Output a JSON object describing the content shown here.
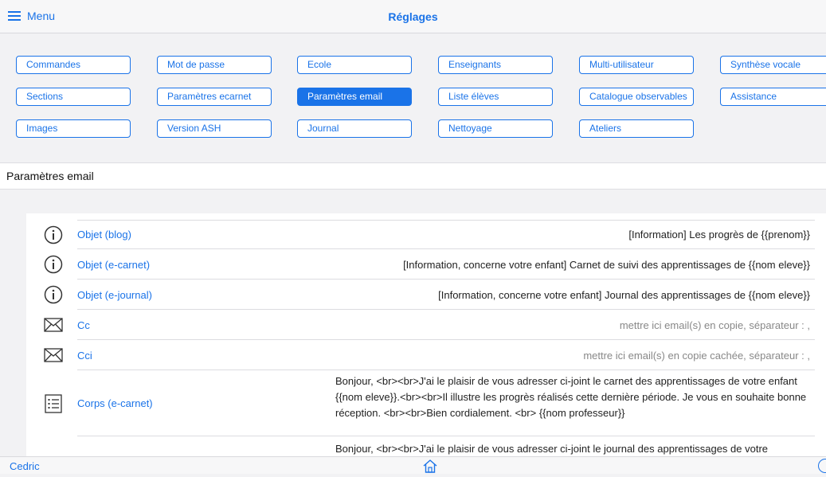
{
  "header": {
    "menu_label": "Menu",
    "title": "Réglages"
  },
  "buttons": [
    {
      "label": "Commandes",
      "active": false
    },
    {
      "label": "Mot de passe",
      "active": false
    },
    {
      "label": "Ecole",
      "active": false
    },
    {
      "label": "Enseignants",
      "active": false
    },
    {
      "label": "Multi-utilisateur",
      "active": false
    },
    {
      "label": "Synthèse vocale",
      "active": false
    },
    {
      "label": "Sections",
      "active": false
    },
    {
      "label": "Paramètres ecarnet",
      "active": false
    },
    {
      "label": "Paramètres email",
      "active": true
    },
    {
      "label": "Liste élèves",
      "active": false
    },
    {
      "label": "Catalogue observables",
      "active": false
    },
    {
      "label": "Assistance",
      "active": false
    },
    {
      "label": "Images",
      "active": false
    },
    {
      "label": "Version ASH",
      "active": false
    },
    {
      "label": "Journal",
      "active": false
    },
    {
      "label": "Nettoyage",
      "active": false
    },
    {
      "label": "Ateliers",
      "active": false
    }
  ],
  "section": {
    "title": "Paramètres email"
  },
  "rows": [
    {
      "icon": "info-icon",
      "label": "Objet (blog)",
      "value": "[Information] Les progrès de {{prenom}}",
      "placeholder": false
    },
    {
      "icon": "info-icon",
      "label": "Objet (e-carnet)",
      "value": "[Information, concerne votre enfant] Carnet de suivi des apprentissages de {{nom eleve}}",
      "placeholder": false
    },
    {
      "icon": "info-icon",
      "label": "Objet (e-journal)",
      "value": "[Information, concerne votre enfant] Journal des apprentissages de {{nom eleve}}",
      "placeholder": false
    },
    {
      "icon": "envelope-icon",
      "label": "Cc",
      "value": "mettre ici email(s) en copie, séparateur : ,",
      "placeholder": true
    },
    {
      "icon": "envelope-icon",
      "label": "Cci",
      "value": "mettre ici email(s) en copie cachée, séparateur : ,",
      "placeholder": true
    }
  ],
  "body_rows": [
    {
      "icon": "list-icon",
      "label": "Corps (e-carnet)",
      "value": "Bonjour, <br><br>J'ai le plaisir de vous adresser ci-joint le carnet des apprentissages de votre enfant {{nom eleve}}.<br><br>Il illustre les progrès réalisés cette dernière période. Je vous en souhaite bonne réception. <br><br>Bien cordialement. <br> {{nom professeur}}"
    },
    {
      "icon": "list-icon",
      "label": "",
      "value": "Bonjour, <br><br>J'ai le plaisir de vous adresser ci-joint le journal des apprentissages de votre"
    }
  ],
  "footer": {
    "user": "Cedric"
  },
  "colors": {
    "accent": "#1a73e8",
    "background": "#f2f2f4"
  }
}
